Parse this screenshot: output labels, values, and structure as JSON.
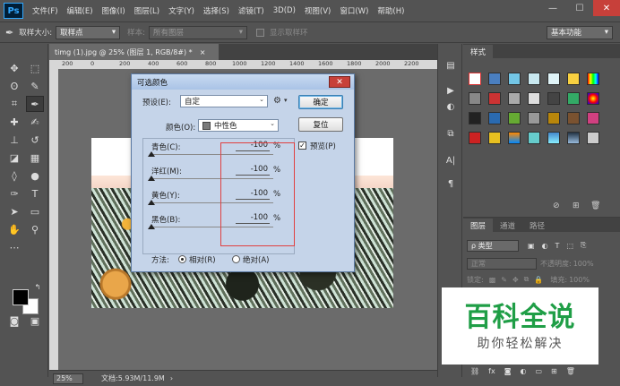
{
  "app": {
    "logo": "Ps"
  },
  "menubar": {
    "items": [
      "文件(F)",
      "编辑(E)",
      "图像(I)",
      "图层(L)",
      "文字(Y)",
      "选择(S)",
      "滤镜(T)",
      "3D(D)",
      "视图(V)",
      "窗口(W)",
      "帮助(H)"
    ],
    "window_controls": [
      "—",
      "☐",
      "✕"
    ]
  },
  "optionsbar": {
    "sample_size_label": "取样大小:",
    "sample_size_value": "取样点",
    "sample_label": "样本:",
    "sample_value": "所有图层",
    "show_ring_label": "显示取样环",
    "workspace_value": "基本功能"
  },
  "document": {
    "tab_title": "timg (1).jpg @ 25% (图层 1, RGB/8#) *",
    "tab_close": "×",
    "ruler_ticks": [
      "200",
      "0",
      "200",
      "400",
      "600",
      "800",
      "1000",
      "1200",
      "1400",
      "1600",
      "1800",
      "2000",
      "2200"
    ]
  },
  "statusbar": {
    "zoom": "25%",
    "doc_info": "文档:5.93M/11.9M"
  },
  "dialog": {
    "title": "可选颜色",
    "close": "✕",
    "preset_label": "预设(E):",
    "preset_value": "自定",
    "ok_label": "确定",
    "reset_label": "复位",
    "preview_label": "预览(P)",
    "preview_checked": "✓",
    "colors_label": "颜色(O):",
    "colors_value": "中性色",
    "sliders": [
      {
        "label": "青色(C):",
        "value": "-100",
        "unit": "%",
        "level": 0.0
      },
      {
        "label": "洋红(M):",
        "value": "-100",
        "unit": "%",
        "level": 0.0
      },
      {
        "label": "黄色(Y):",
        "value": "-100",
        "unit": "%",
        "level": 0.0
      },
      {
        "label": "黑色(B):",
        "value": "-100",
        "unit": "%",
        "level": 0.0
      }
    ],
    "method_label": "方法:",
    "method_relative": "相对(R)",
    "method_absolute": "绝对(A)"
  },
  "styles_panel": {
    "tab": "样式"
  },
  "layers_panel": {
    "tabs": [
      "图层",
      "通道",
      "路径"
    ],
    "kind_label": "ρ 类型",
    "blend_mode": "正常",
    "opacity_label": "不透明度:",
    "opacity_value": "100%",
    "lock_label": "锁定:",
    "fill_label": "填充:",
    "fill_value": "100%"
  },
  "watermark": {
    "title": "百科全说",
    "subtitle": "助你轻松解决"
  }
}
